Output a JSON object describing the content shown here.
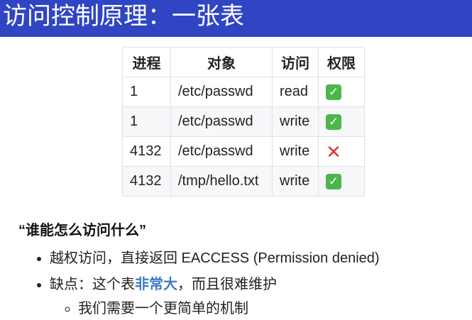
{
  "slide": {
    "title": "访问控制原理：一张表"
  },
  "table": {
    "headers": [
      "进程",
      "对象",
      "访问",
      "权限"
    ],
    "rows": [
      {
        "pid": "1",
        "object": "/etc/passwd",
        "access": "read",
        "allowed": true
      },
      {
        "pid": "1",
        "object": "/etc/passwd",
        "access": "write",
        "allowed": true
      },
      {
        "pid": "4132",
        "object": "/etc/passwd",
        "access": "write",
        "allowed": false
      },
      {
        "pid": "4132",
        "object": "/tmp/hello.txt",
        "access": "write",
        "allowed": true
      }
    ],
    "allowed_glyph": "✓",
    "denied_glyph": "✕",
    "allowed_color": "#4cb64c",
    "denied_color": "#d93a3a"
  },
  "section": {
    "quote": "“谁能怎么访问什么”",
    "bullet1": "越权访问，直接返回 EACCESS (Permission denied)",
    "bullet2_pre": "缺点：这个表",
    "bullet2_emph": "非常大",
    "bullet2_post": "，而且很难维护",
    "sub1": "我们需要一个更简单的机制"
  },
  "colors": {
    "title_bar": "#2f45c4",
    "emphasis": "#3b7bc8"
  }
}
